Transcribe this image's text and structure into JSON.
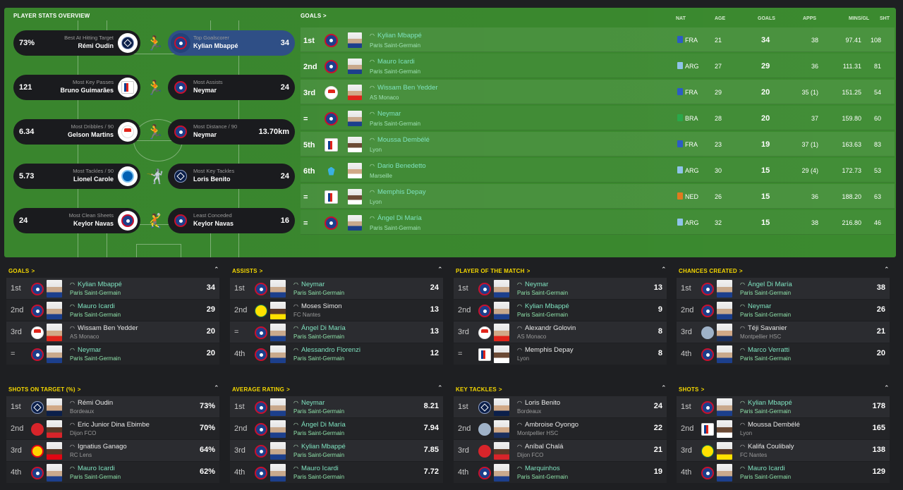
{
  "overview_title": "PLAYER STATS OVERVIEW",
  "goals_title": "GOALS",
  "chevron": ">",
  "overview": [
    {
      "left_val": "73%",
      "left_cap": "Best At Hitting Target",
      "left_name": "Rémi Oudin",
      "left_club": "bor",
      "icon": "shooting-player-icon",
      "right_cap": "Top Goalscorer",
      "right_name": "Kylian Mbappé",
      "right_club": "psg",
      "right_val": "34",
      "highlight": true
    },
    {
      "left_val": "121",
      "left_cap": "Most Key Passes",
      "left_name": "Bruno Guimarães",
      "left_club": "lyo",
      "icon": "passing-player-icon",
      "right_cap": "Most Assists",
      "right_name": "Neymar",
      "right_club": "psg",
      "right_val": "24",
      "highlight": false
    },
    {
      "left_val": "6.34",
      "left_cap": "Most Dribbles / 90",
      "left_name": "Gelson Martins",
      "left_club": "mon",
      "icon": "dribbling-player-icon",
      "right_cap": "Most Distance / 90",
      "right_name": "Neymar",
      "right_club": "psg",
      "right_val": "13.70km",
      "highlight": false
    },
    {
      "left_val": "5.73",
      "left_cap": "Most Tackles / 90",
      "left_name": "Lionel Carole",
      "left_club": "str",
      "icon": "tackling-player-icon",
      "right_cap": "Most Key Tackles",
      "right_name": "Loris Benito",
      "right_club": "bor",
      "right_val": "24",
      "highlight": false
    },
    {
      "left_val": "24",
      "left_cap": "Most Clean Sheets",
      "left_name": "Keylor Navas",
      "left_club": "psg",
      "icon": "goalkeeper-diving-icon",
      "right_cap": "Least Conceded",
      "right_name": "Keylor Navas",
      "right_club": "psg",
      "right_val": "16",
      "highlight": false
    }
  ],
  "goals_headers": {
    "nat": "NAT",
    "age": "AGE",
    "goals": "GOALS",
    "apps": "APPS",
    "mins": "MINS/GL",
    "sht": "SHT"
  },
  "goals_rows": [
    {
      "rank": "1st",
      "club": "psg",
      "name": "Kylian Mbappé",
      "team": "Paris Saint-Germain",
      "nat": "FRA",
      "age": "21",
      "goals": "34",
      "apps": "38",
      "mins": "97.41",
      "sht": "108",
      "flag": "#2c5cc5",
      "face": ""
    },
    {
      "rank": "2nd",
      "club": "psg",
      "name": "Mauro Icardi",
      "team": "Paris Saint-Germain",
      "nat": "ARG",
      "age": "27",
      "goals": "29",
      "apps": "36",
      "mins": "111.31",
      "sht": "81",
      "flag": "#8fc3ea",
      "face": ""
    },
    {
      "rank": "3rd",
      "club": "mon",
      "name": "Wissam Ben Yedder",
      "team": "AS Monaco",
      "nat": "FRA",
      "age": "29",
      "goals": "20",
      "apps": "35 (1)",
      "mins": "151.25",
      "sht": "54",
      "flag": "#2c5cc5",
      "face": "mon"
    },
    {
      "rank": "=",
      "club": "psg",
      "name": "Neymar",
      "team": "Paris Saint-Germain",
      "nat": "BRA",
      "age": "28",
      "goals": "20",
      "apps": "37",
      "mins": "159.80",
      "sht": "60",
      "flag": "#2aa84a",
      "face": ""
    },
    {
      "rank": "5th",
      "club": "lyo",
      "name": "Moussa Dembélé",
      "team": "Lyon",
      "nat": "FRA",
      "age": "23",
      "goals": "19",
      "apps": "37 (1)",
      "mins": "163.63",
      "sht": "83",
      "flag": "#2c5cc5",
      "face": "lyo"
    },
    {
      "rank": "6th",
      "club": "mar",
      "name": "Dario Benedetto",
      "team": "Marseille",
      "nat": "ARG",
      "age": "30",
      "goals": "15",
      "apps": "29 (4)",
      "mins": "172.73",
      "sht": "53",
      "flag": "#8fc3ea",
      "face": "mar"
    },
    {
      "rank": "=",
      "club": "lyo",
      "name": "Memphis Depay",
      "team": "Lyon",
      "nat": "NED",
      "age": "26",
      "goals": "15",
      "apps": "36",
      "mins": "188.20",
      "sht": "63",
      "flag": "#e07a1f",
      "face": "lyo"
    },
    {
      "rank": "=",
      "club": "psg",
      "name": "Ángel Di María",
      "team": "Paris Saint-Germain",
      "nat": "ARG",
      "age": "32",
      "goals": "15",
      "apps": "38",
      "mins": "216.80",
      "sht": "46",
      "flag": "#8fc3ea",
      "face": ""
    }
  ],
  "panels": [
    {
      "title": "GOALS",
      "rows": [
        {
          "rank": "1st",
          "club": "psg",
          "face": "",
          "name": "Kylian Mbappé",
          "team": "Paris Saint-Germain",
          "value": "34",
          "own": true
        },
        {
          "rank": "2nd",
          "club": "psg",
          "face": "",
          "name": "Mauro Icardi",
          "team": "Paris Saint-Germain",
          "value": "29",
          "own": true
        },
        {
          "rank": "3rd",
          "club": "mon",
          "face": "mon",
          "name": "Wissam Ben Yedder",
          "team": "AS Monaco",
          "value": "20",
          "own": false
        },
        {
          "rank": "=",
          "club": "psg",
          "face": "",
          "name": "Neymar",
          "team": "Paris Saint-Germain",
          "value": "20",
          "own": true
        }
      ]
    },
    {
      "title": "ASSISTS",
      "rows": [
        {
          "rank": "1st",
          "club": "psg",
          "face": "",
          "name": "Neymar",
          "team": "Paris Saint-Germain",
          "value": "24",
          "own": true
        },
        {
          "rank": "2nd",
          "club": "nan",
          "face": "nan",
          "name": "Moses Simon",
          "team": "FC Nantes",
          "value": "13",
          "own": false
        },
        {
          "rank": "=",
          "club": "psg",
          "face": "",
          "name": "Ángel Di María",
          "team": "Paris Saint-Germain",
          "value": "13",
          "own": true
        },
        {
          "rank": "4th",
          "club": "psg",
          "face": "",
          "name": "Alessandro Florenzi",
          "team": "Paris Saint-Germain",
          "value": "12",
          "own": true
        }
      ]
    },
    {
      "title": "PLAYER OF THE MATCH",
      "rows": [
        {
          "rank": "1st",
          "club": "psg",
          "face": "",
          "name": "Neymar",
          "team": "Paris Saint-Germain",
          "value": "13",
          "own": true
        },
        {
          "rank": "2nd",
          "club": "psg",
          "face": "",
          "name": "Kylian Mbappé",
          "team": "Paris Saint-Germain",
          "value": "9",
          "own": true
        },
        {
          "rank": "3rd",
          "club": "mon",
          "face": "mon",
          "name": "Alexandr Golovin",
          "team": "AS Monaco",
          "value": "8",
          "own": false
        },
        {
          "rank": "=",
          "club": "lyo",
          "face": "lyo",
          "name": "Memphis Depay",
          "team": "Lyon",
          "value": "8",
          "own": false
        }
      ]
    },
    {
      "title": "CHANCES CREATED",
      "rows": [
        {
          "rank": "1st",
          "club": "psg",
          "face": "",
          "name": "Ángel Di María",
          "team": "Paris Saint-Germain",
          "value": "38",
          "own": true
        },
        {
          "rank": "2nd",
          "club": "psg",
          "face": "",
          "name": "Neymar",
          "team": "Paris Saint-Germain",
          "value": "26",
          "own": true
        },
        {
          "rank": "3rd",
          "club": "mon2",
          "face": "mhsc",
          "name": "Téji Savanier",
          "team": "Montpellier HSC",
          "value": "21",
          "own": false
        },
        {
          "rank": "4th",
          "club": "psg",
          "face": "",
          "name": "Marco Verratti",
          "team": "Paris Saint-Germain",
          "value": "20",
          "own": true
        }
      ]
    },
    {
      "title": "SHOTS ON TARGET (%)",
      "rows": [
        {
          "rank": "1st",
          "club": "bor",
          "face": "bor",
          "name": "Rémi Oudin",
          "team": "Bordeaux",
          "value": "73%",
          "own": false
        },
        {
          "rank": "2nd",
          "club": "dij",
          "face": "dij",
          "name": "Eric Junior Dina Ebimbe",
          "team": "Dijon FCO",
          "value": "70%",
          "own": false
        },
        {
          "rank": "3rd",
          "club": "len",
          "face": "len",
          "name": "Ignatius Ganago",
          "team": "RC Lens",
          "value": "64%",
          "own": false
        },
        {
          "rank": "4th",
          "club": "psg",
          "face": "",
          "name": "Mauro Icardi",
          "team": "Paris Saint-Germain",
          "value": "62%",
          "own": true
        }
      ]
    },
    {
      "title": "AVERAGE RATING",
      "rows": [
        {
          "rank": "1st",
          "club": "psg",
          "face": "",
          "name": "Neymar",
          "team": "Paris Saint-Germain",
          "value": "8.21",
          "own": true
        },
        {
          "rank": "2nd",
          "club": "psg",
          "face": "",
          "name": "Ángel Di María",
          "team": "Paris Saint-Germain",
          "value": "7.94",
          "own": true
        },
        {
          "rank": "3rd",
          "club": "psg",
          "face": "",
          "name": "Kylian Mbappé",
          "team": "Paris Saint-Germain",
          "value": "7.85",
          "own": true
        },
        {
          "rank": "4th",
          "club": "psg",
          "face": "",
          "name": "Mauro Icardi",
          "team": "Paris Saint-Germain",
          "value": "7.72",
          "own": true
        }
      ]
    },
    {
      "title": "KEY TACKLES",
      "rows": [
        {
          "rank": "1st",
          "club": "bor",
          "face": "bor",
          "name": "Loris Benito",
          "team": "Bordeaux",
          "value": "24",
          "own": false
        },
        {
          "rank": "2nd",
          "club": "mon2",
          "face": "mhsc",
          "name": "Ambroise Oyongo",
          "team": "Montpellier HSC",
          "value": "22",
          "own": false
        },
        {
          "rank": "3rd",
          "club": "dij",
          "face": "dij",
          "name": "Aníbal Chalá",
          "team": "Dijon FCO",
          "value": "21",
          "own": false
        },
        {
          "rank": "4th",
          "club": "psg",
          "face": "",
          "name": "Marquinhos",
          "team": "Paris Saint-Germain",
          "value": "19",
          "own": true
        }
      ]
    },
    {
      "title": "SHOTS",
      "rows": [
        {
          "rank": "1st",
          "club": "psg",
          "face": "",
          "name": "Kylian Mbappé",
          "team": "Paris Saint-Germain",
          "value": "178",
          "own": true
        },
        {
          "rank": "2nd",
          "club": "lyo",
          "face": "lyo",
          "name": "Moussa Dembélé",
          "team": "Lyon",
          "value": "165",
          "own": false
        },
        {
          "rank": "3rd",
          "club": "nan",
          "face": "nan",
          "name": "Kalifa Coulibaly",
          "team": "FC Nantes",
          "value": "138",
          "own": false
        },
        {
          "rank": "4th",
          "club": "psg",
          "face": "",
          "name": "Mauro Icardi",
          "team": "Paris Saint-Germain",
          "value": "129",
          "own": true
        }
      ]
    }
  ]
}
